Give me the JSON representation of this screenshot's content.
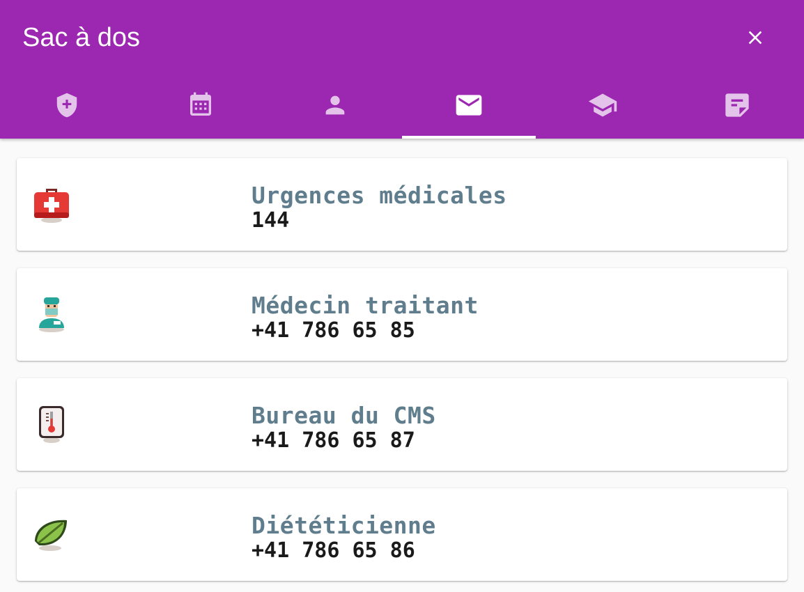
{
  "header": {
    "title": "Sac à dos",
    "close_icon": "close-icon"
  },
  "colors": {
    "primary": "#9c27b0",
    "name_text": "#5f7d8c",
    "phone_text": "#1a1a1a",
    "background": "#fafafa"
  },
  "tabs": [
    {
      "icon": "shield-plus-icon",
      "active": false
    },
    {
      "icon": "calendar-icon",
      "active": false
    },
    {
      "icon": "person-icon",
      "active": false
    },
    {
      "icon": "mail-icon",
      "active": true
    },
    {
      "icon": "school-icon",
      "active": false
    },
    {
      "icon": "note-icon",
      "active": false
    }
  ],
  "contacts": [
    {
      "name": "Urgences médicales",
      "phone": "144",
      "icon": "first-aid-kit-icon"
    },
    {
      "name": "Médecin traitant",
      "phone": "+41 786 65 85",
      "icon": "doctor-icon"
    },
    {
      "name": "Bureau du CMS",
      "phone": "+41 786 65 87",
      "icon": "thermometer-icon"
    },
    {
      "name": "Diététicienne",
      "phone": "+41 786 65 86",
      "icon": "leaf-icon"
    }
  ]
}
